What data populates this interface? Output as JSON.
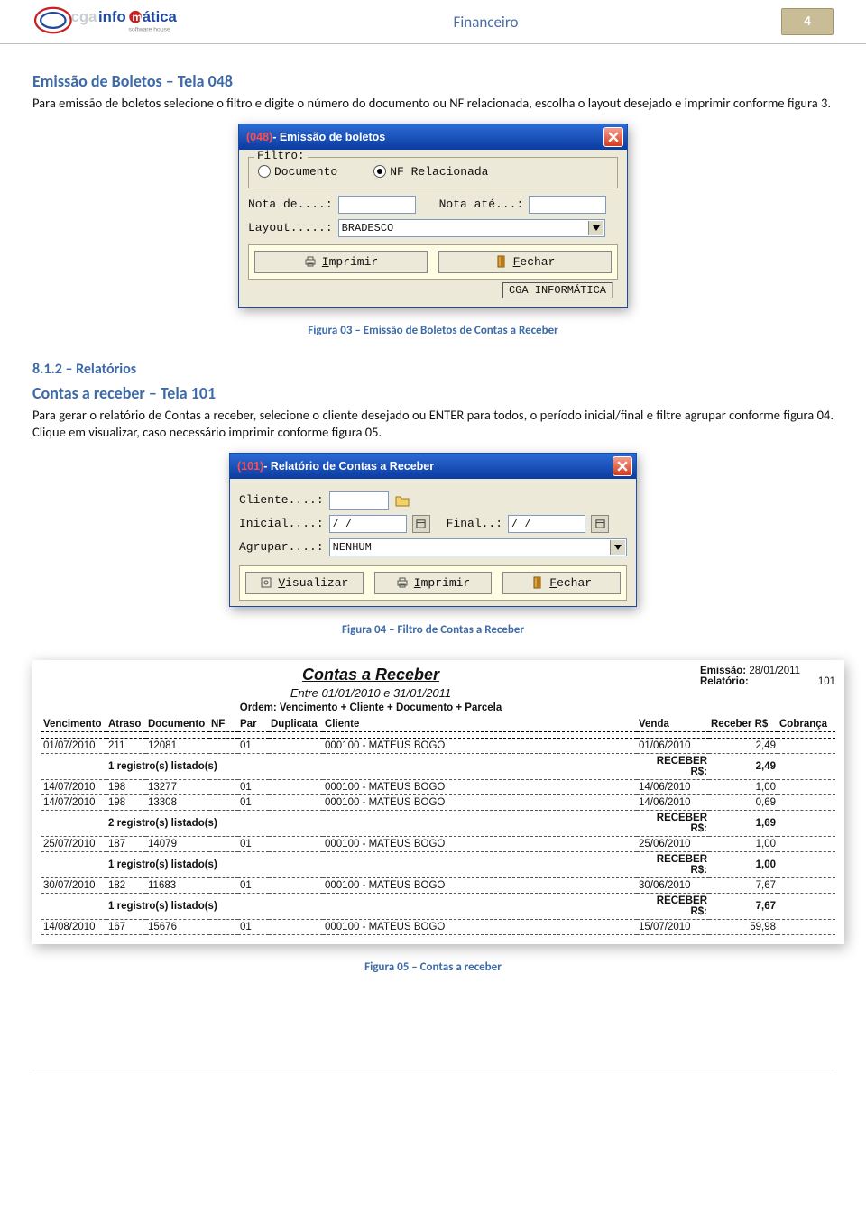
{
  "header": {
    "title": "Financeiro",
    "page_number": "4",
    "logo_main": "cgainfo",
    "logo_suffix": "mática",
    "logo_tag": "software house"
  },
  "section1": {
    "heading": "Emissão de Boletos – Tela 048",
    "para": "Para emissão de boletos selecione o filtro e digite o número do documento ou NF relacionada, escolha o layout desejado e imprimir conforme figura 3."
  },
  "dialog1": {
    "code": "(048)",
    "title": " - Emissão de boletos",
    "filtro_legend": "Filtro:",
    "radio_documento": "Documento",
    "radio_nf": "NF Relacionada",
    "lbl_nota_de": "Nota de....:",
    "lbl_nota_ate": "Nota até...:",
    "lbl_layout": "Layout.....:",
    "layout_value": "BRADESCO",
    "btn_imprimir": "Imprimir",
    "btn_fechar": "Fechar",
    "status": "CGA INFORMÁTICA"
  },
  "caption1": "Figura 03 – Emissão de Boletos de Contas a Receber",
  "section2": {
    "num": "8.1.2 – Relatórios",
    "heading": "Contas a receber – Tela 101",
    "para": "Para gerar o relatório de Contas a receber, selecione o cliente desejado ou ENTER para todos, o período inicial/final e filtre agrupar conforme figura 04. Clique em visualizar, caso necessário imprimir conforme figura 05."
  },
  "dialog2": {
    "code": "(101)",
    "title": " - Relatório de Contas a Receber",
    "lbl_cliente": "Cliente....:",
    "lbl_inicial": "Inicial....:",
    "date_placeholder": "  /  /",
    "lbl_final": "Final..:",
    "lbl_agrupar": "Agrupar....:",
    "agrupar_value": "NENHUM",
    "btn_visualizar": "Visualizar",
    "btn_imprimir": "Imprimir",
    "btn_fechar": "Fechar"
  },
  "caption2": "Figura 04 – Filtro de Contas a Receber",
  "report": {
    "title": "Contas a Receber",
    "subtitle": "Entre 01/01/2010 e 31/01/2011",
    "order": "Ordem: Vencimento + Cliente + Documento + Parcela",
    "emissao_k": "Emissão:",
    "emissao_v": "28/01/2011",
    "relatorio_k": "Relatório:",
    "relatorio_v": "101",
    "cols": {
      "vencimento": "Vencimento",
      "atraso": "Atraso",
      "documento": "Documento",
      "nf": "NF",
      "par": "Par",
      "duplicata": "Duplicata",
      "cliente": "Cliente",
      "venda": "Venda",
      "receber": "Receber R$",
      "cobranca": "Cobrança"
    },
    "rows": [
      {
        "venc": "01/07/2010",
        "atraso": "211",
        "doc": "12081",
        "par": "01",
        "cli": "000100 - MATEUS BOGO",
        "venda": "01/06/2010",
        "rec": "2,49"
      },
      {
        "subtotal": "1 registro(s) listado(s)",
        "lblr": "RECEBER R$:",
        "rec": "2,49"
      },
      {
        "venc": "14/07/2010",
        "atraso": "198",
        "doc": "13277",
        "par": "01",
        "cli": "000100 - MATEUS BOGO",
        "venda": "14/06/2010",
        "rec": "1,00"
      },
      {
        "venc": "14/07/2010",
        "atraso": "198",
        "doc": "13308",
        "par": "01",
        "cli": "000100 - MATEUS BOGO",
        "venda": "14/06/2010",
        "rec": "0,69"
      },
      {
        "subtotal": "2 registro(s) listado(s)",
        "lblr": "RECEBER R$:",
        "rec": "1,69"
      },
      {
        "venc": "25/07/2010",
        "atraso": "187",
        "doc": "14079",
        "par": "01",
        "cli": "000100 - MATEUS BOGO",
        "venda": "25/06/2010",
        "rec": "1,00"
      },
      {
        "subtotal": "1 registro(s) listado(s)",
        "lblr": "RECEBER R$:",
        "rec": "1,00"
      },
      {
        "venc": "30/07/2010",
        "atraso": "182",
        "doc": "11683",
        "par": "01",
        "cli": "000100 - MATEUS BOGO",
        "venda": "30/06/2010",
        "rec": "7,67"
      },
      {
        "subtotal": "1 registro(s) listado(s)",
        "lblr": "RECEBER R$:",
        "rec": "7,67"
      },
      {
        "venc": "14/08/2010",
        "atraso": "167",
        "doc": "15676",
        "par": "01",
        "cli": "000100 - MATEUS BOGO",
        "venda": "15/07/2010",
        "rec": "59,98"
      }
    ]
  },
  "caption3": "Figura 05 – Contas a receber"
}
